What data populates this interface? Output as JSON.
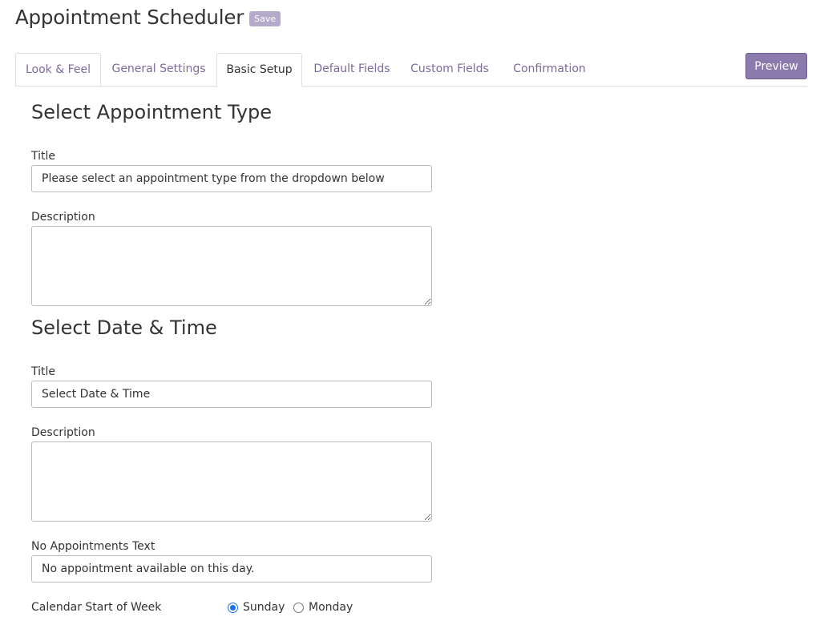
{
  "app": {
    "title": "Appointment Scheduler",
    "save_label": "Save",
    "preview_label": "Preview"
  },
  "tabs": [
    {
      "label": "Look & Feel"
    },
    {
      "label": "General Settings"
    },
    {
      "label": "Basic Setup",
      "active": true
    },
    {
      "label": "Default Fields"
    },
    {
      "label": "Custom Fields"
    },
    {
      "label": "Confirmation"
    }
  ],
  "appointment_type": {
    "heading": "Select Appointment Type",
    "title_label": "Title",
    "title_value": "Please select an appointment type from the dropdown below",
    "description_label": "Description",
    "description_value": ""
  },
  "date_time": {
    "heading": "Select Date & Time",
    "title_label": "Title",
    "title_value": "Select Date & Time",
    "description_label": "Description",
    "description_value": "",
    "no_appointments_label": "No Appointments Text",
    "no_appointments_value": "No appointment available on this day."
  },
  "week_start": {
    "label": "Calendar Start of Week",
    "options": [
      "Sunday",
      "Monday"
    ],
    "selected": "Sunday"
  },
  "colors": {
    "accent": "#8b7bac",
    "tab_text": "#7c6a9c",
    "radio_selected": "#1a73e8"
  }
}
